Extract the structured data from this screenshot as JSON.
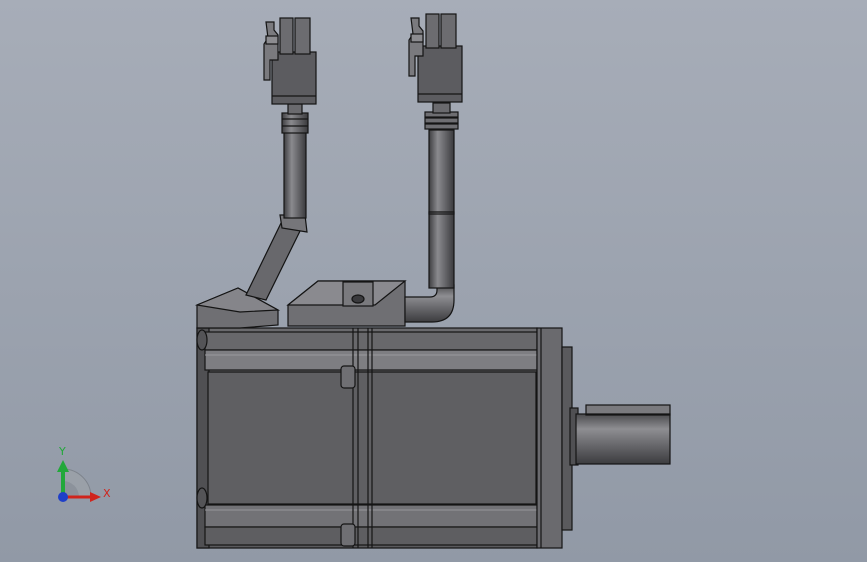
{
  "viewport": {
    "background_top": "#a7adb8",
    "background_bottom": "#9199a6"
  },
  "model": {
    "body_color": "#5f5f62",
    "edge_color": "#141414",
    "highlight_color": "#8a8a8e",
    "shadow_color": "#48484b"
  },
  "triad": {
    "x_label": "X",
    "y_label": "Y",
    "x_color": "#d0241c",
    "y_color": "#22a83a",
    "z_color": "#1f3fc8"
  }
}
